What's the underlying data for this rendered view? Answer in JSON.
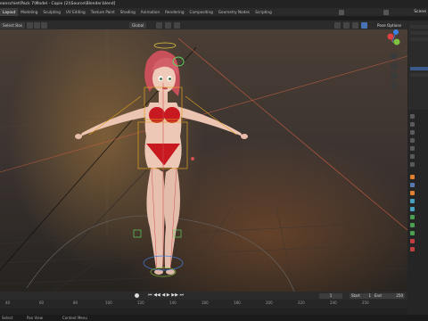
{
  "window": {
    "file_path": "eanschiet\\Pack 7\\Model - Copie (2)\\Source\\Blender.blend]"
  },
  "workspace_tabs": [
    "Layout",
    "Modeling",
    "Sculpting",
    "UV Editing",
    "Texture Paint",
    "Shading",
    "Animation",
    "Rendering",
    "Compositing",
    "Geometry Nodes",
    "Scripting"
  ],
  "active_tab": "Layout",
  "scene_label": "Scene",
  "viewport_header": {
    "select_mode": "Select Box",
    "orientation": "Global",
    "pose_options": "Pose Options"
  },
  "timeline": {
    "current_frame": "1",
    "start_label": "Start",
    "start_value": "1",
    "end_label": "End",
    "end_value": "250",
    "ruler_ticks": [
      "40",
      "60",
      "80",
      "100",
      "120",
      "140",
      "160",
      "180",
      "200",
      "220",
      "240",
      "250"
    ]
  },
  "statusbar": {
    "left": "Select",
    "right": "Pan View",
    "context": "Context Menu"
  },
  "colors": {
    "accent": "#4772b3",
    "bone_select": "#e0a020",
    "ring_green": "#5fd05f",
    "gizmo_x": "#e04040",
    "gizmo_y": "#7fc040",
    "gizmo_z": "#4080e0"
  }
}
